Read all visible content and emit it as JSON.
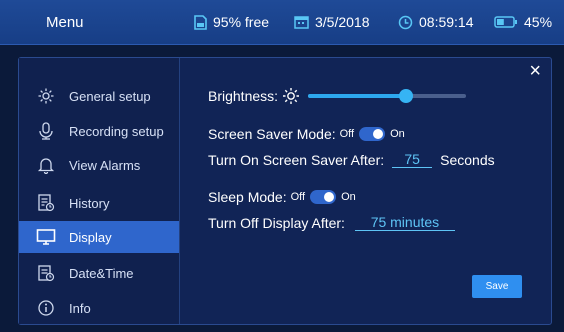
{
  "topbar": {
    "menu_label": "Menu",
    "storage": "95% free",
    "date": "3/5/2018",
    "time": "08:59:14",
    "battery": "45%",
    "battery_level": 0.45,
    "accent_color": "#59c7f5"
  },
  "sidebar": {
    "items": [
      {
        "label": "General setup",
        "icon": "gear-icon"
      },
      {
        "label": "Recording setup",
        "icon": "recording-icon"
      },
      {
        "label": "View Alarms",
        "icon": "bell-icon"
      },
      {
        "label": "History",
        "icon": "history-icon"
      },
      {
        "label": "Display",
        "icon": "monitor-icon",
        "active": true
      },
      {
        "label": "Date&Time",
        "icon": "calendar-clock-icon"
      },
      {
        "label": "Info",
        "icon": "info-icon"
      }
    ]
  },
  "display": {
    "brightness_label": "Brightness:",
    "brightness_level": 0.62,
    "screen_saver_label": "Screen Saver Mode:",
    "screen_saver_off": "Off",
    "screen_saver_on": "On",
    "screen_saver_after_label": "Turn On Screen Saver After:",
    "screen_saver_after_value": "75",
    "screen_saver_after_unit": "Seconds",
    "sleep_label": "Sleep Mode:",
    "sleep_off": "Off",
    "sleep_on": "On",
    "display_off_label": "Turn Off Display After:",
    "display_off_value": "75 minutes",
    "save_label": "Save",
    "close_label": "×"
  }
}
